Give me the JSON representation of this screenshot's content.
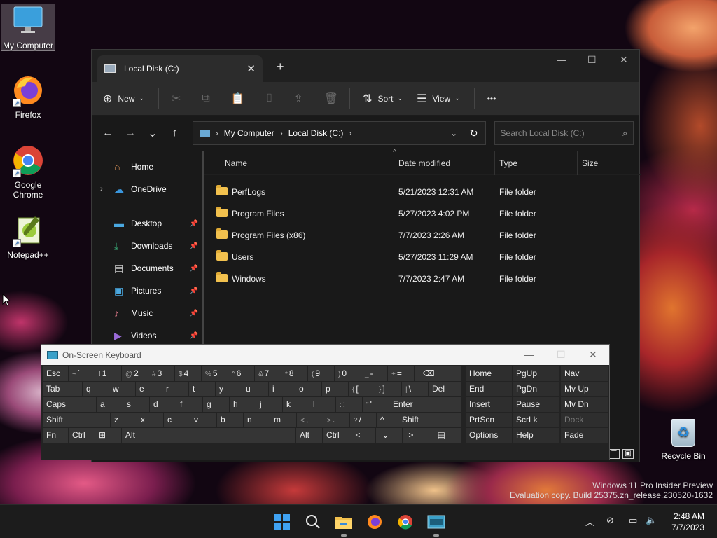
{
  "desktop": {
    "icons": [
      {
        "label": "My Computer"
      },
      {
        "label": "Firefox"
      },
      {
        "label": "Google Chrome"
      },
      {
        "label": "Notepad++"
      }
    ],
    "recycle_bin": "Recycle Bin",
    "watermark_line1": "Windows 11 Pro Insider Preview",
    "watermark_line2": "Evaluation copy. Build 25375.zn_release.230520-1632"
  },
  "explorer": {
    "tab_title": "Local Disk (C:)",
    "toolbar": {
      "new": "New",
      "sort": "Sort",
      "view": "View",
      "more": "•••"
    },
    "breadcrumb": [
      "My Computer",
      "Local Disk (C:)"
    ],
    "search_placeholder": "Search Local Disk (C:)",
    "nav": {
      "home": "Home",
      "onedrive": "OneDrive",
      "quick": [
        "Desktop",
        "Downloads",
        "Documents",
        "Pictures",
        "Music",
        "Videos"
      ]
    },
    "columns": {
      "name": "Name",
      "date": "Date modified",
      "type": "Type",
      "size": "Size"
    },
    "rows": [
      {
        "name": "PerfLogs",
        "date": "5/21/2023 12:31 AM",
        "type": "File folder"
      },
      {
        "name": "Program Files",
        "date": "5/27/2023 4:02 PM",
        "type": "File folder"
      },
      {
        "name": "Program Files (x86)",
        "date": "7/7/2023 2:26 AM",
        "type": "File folder"
      },
      {
        "name": "Users",
        "date": "5/27/2023 11:29 AM",
        "type": "File folder"
      },
      {
        "name": "Windows",
        "date": "7/7/2023 2:47 AM",
        "type": "File folder"
      }
    ]
  },
  "osk": {
    "title": "On-Screen Keyboard"
  },
  "clock": {
    "time": "2:48 AM",
    "date": "7/7/2023"
  }
}
